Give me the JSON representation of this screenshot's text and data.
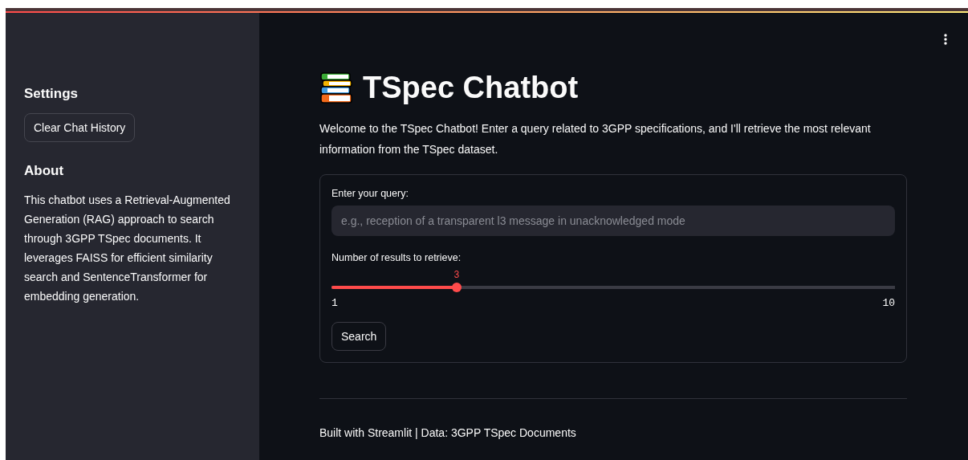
{
  "sidebar": {
    "settings_heading": "Settings",
    "clear_button": "Clear Chat History",
    "about_heading": "About",
    "about_text": "This chatbot uses a Retrieval-Augmented Generation (RAG) approach to search through 3GPP TSpec documents. It leverages FAISS for efficient similarity search and SentenceTransformer for embedding generation."
  },
  "main": {
    "title": "TSpec Chatbot",
    "intro": "Welcome to the TSpec Chatbot! Enter a query related to 3GPP specifications, and I'll retrieve the most relevant information from the TSpec dataset.",
    "form": {
      "query_label": "Enter your query:",
      "query_placeholder": "e.g., reception of a transparent l3 message in unacknowledged mode",
      "slider_label": "Number of results to retrieve:",
      "slider": {
        "value": "3",
        "min": "1",
        "max": "10",
        "level": 0.222
      },
      "search_button": "Search"
    },
    "footer": "Built with Streamlit | Data: 3GPP TSpec Documents"
  }
}
